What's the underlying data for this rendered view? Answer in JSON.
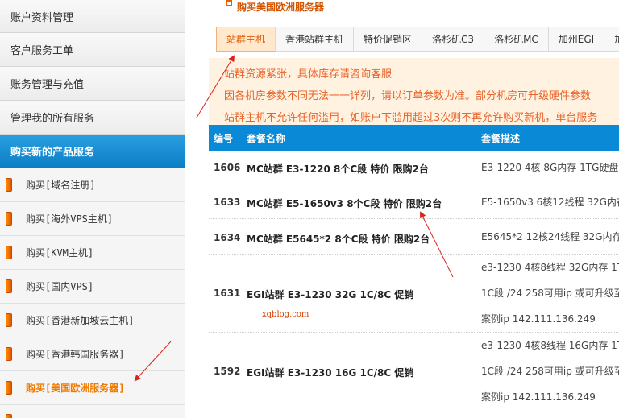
{
  "sidebar": {
    "top_items": [
      "账户资料管理",
      "客户服务工单",
      "账务管理与充值",
      "管理我的所有服务"
    ],
    "active_section": "购买新的产品服务",
    "sub_items": [
      "购买[域名注册]",
      "购买[海外VPS主机]",
      "购买[KVM主机]",
      "购买[国内VPS]",
      "购买[香港新加坡云主机]",
      "购买[香港韩国服务器]",
      "购买[美国欧洲服务器]"
    ]
  },
  "main": {
    "page_title": "购买美国欧洲服务器",
    "tabs": [
      "站群主机",
      "香港站群主机",
      "特价促销区",
      "洛杉矶C3",
      "洛杉矶MC",
      "加州EGI",
      "加州"
    ],
    "notice_lines": [
      "站群资源紧张，具体库存请咨询客服",
      "因各机房参数不同无法一一详列，请以订单参数为准。部分机房可升级硬件参数",
      "站群主机不允许任何滥用，如账户下滥用超过3次则不再允许购买新机，单台服务"
    ],
    "table": {
      "headers": [
        "编号",
        "套餐名称",
        "套餐描述"
      ],
      "rows": [
        {
          "id": "1606",
          "name": "MC站群 E3-1220 8个C段 特价 限购2台",
          "desc": [
            "E3-1220 4核 8G内存 1TG硬盘 流"
          ]
        },
        {
          "id": "1633",
          "name": "MC站群 E5-1650v3 8个C段 特价 限购2台",
          "desc": [
            "E5-1650v3 6核12线程 32G内存"
          ]
        },
        {
          "id": "1634",
          "name": "MC站群 E5645*2 8个C段 特价 限购2台",
          "desc": [
            "E5645*2 12核24线程 32G内存 1"
          ]
        },
        {
          "id": "1631",
          "name": "EGI站群 E3-1230 32G 1C/8C 促销",
          "desc": [
            "e3-1230 4核8线程 32G内存 1T硬",
            "1C段 /24 258可用ip 或可升级至",
            "案例ip 142.111.136.249"
          ]
        },
        {
          "id": "1592",
          "name": "EGI站群 E3-1230 16G 1C/8C 促销",
          "desc": [
            "e3-1230 4核8线程 16G内存 1T硬",
            "1C段 /24 258可用ip 或可升级至",
            "案例ip 142.111.136.249"
          ]
        }
      ]
    },
    "watermark": "xqblog.com"
  },
  "colors": {
    "accent_blue": "#0a8ad6",
    "accent_orange": "#e05a00",
    "annotation_red": "#d9241c"
  }
}
